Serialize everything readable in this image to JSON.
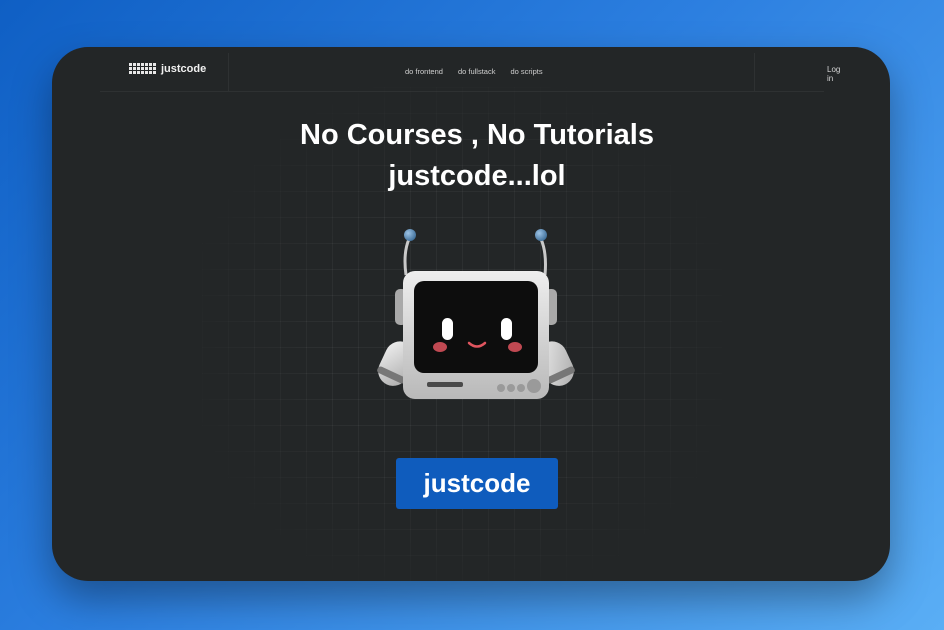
{
  "brand": {
    "name": "justcode",
    "icon": "keyboard-icon"
  },
  "nav": {
    "links": [
      "do frontend",
      "do fullstack",
      "do scripts"
    ],
    "login": "Log in"
  },
  "hero": {
    "line1": "No Courses , No Tutorials",
    "line2": "justcode...lol",
    "image": "robot-monitor-mascot",
    "cta": "justcode"
  },
  "colors": {
    "background_gradient": [
      "#0f5fc4",
      "#5aaef5"
    ],
    "panel": "#232627",
    "accent": "#0f5cbd",
    "text": "#ffffff"
  }
}
